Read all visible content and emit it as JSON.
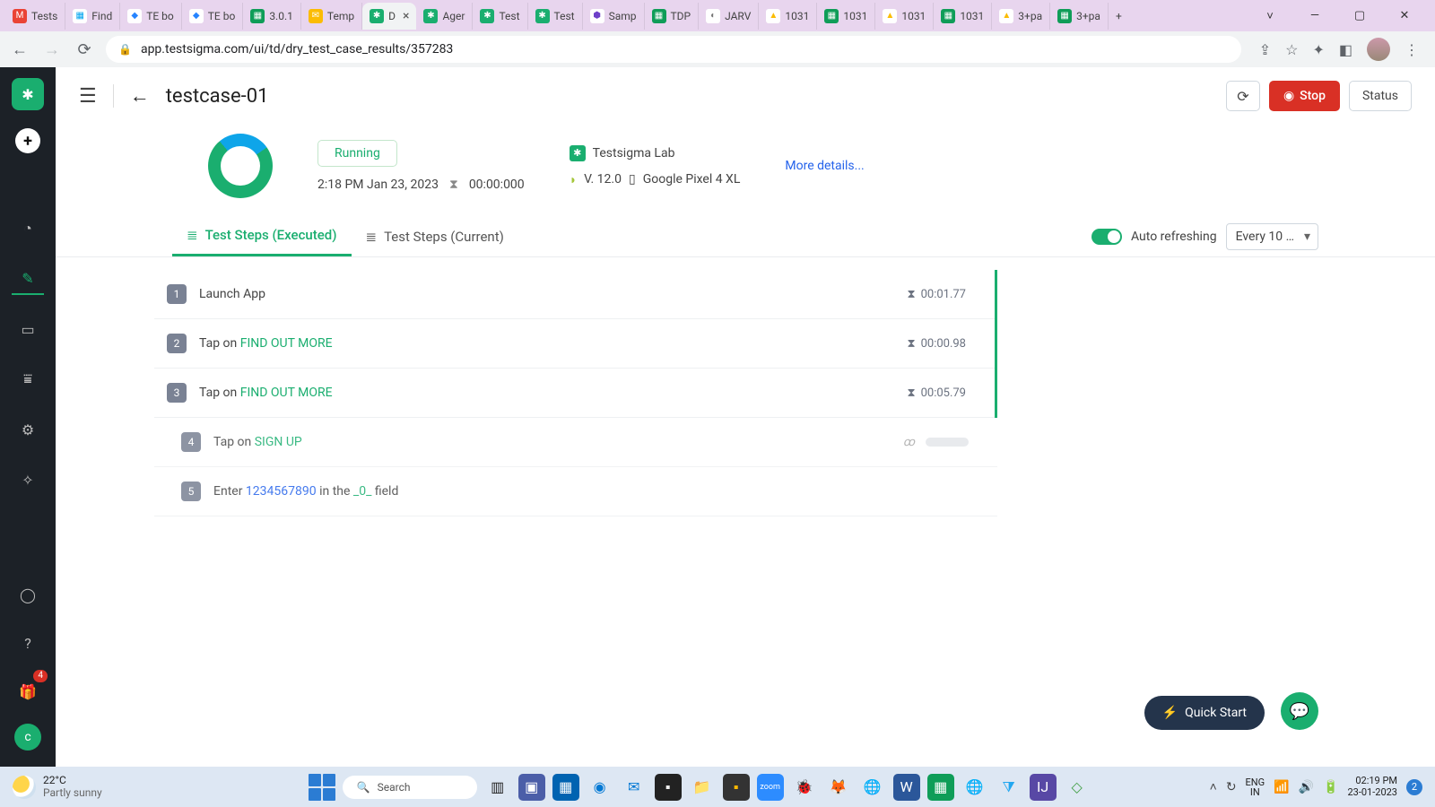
{
  "browser": {
    "tabs": [
      {
        "favicon": "M",
        "faviconBg": "#ea4335",
        "faviconColor": "#fff",
        "label": "Tests"
      },
      {
        "favicon": "▦",
        "faviconBg": "#fff",
        "faviconColor": "#00a4ef",
        "label": "Find"
      },
      {
        "favicon": "◆",
        "faviconBg": "#fff",
        "faviconColor": "#2684ff",
        "label": "TE bo"
      },
      {
        "favicon": "◆",
        "faviconBg": "#fff",
        "faviconColor": "#2684ff",
        "label": "TE bo"
      },
      {
        "favicon": "▦",
        "faviconBg": "#0f9d58",
        "faviconColor": "#fff",
        "label": "3.0.1"
      },
      {
        "favicon": "✉",
        "faviconBg": "#fbbc04",
        "faviconColor": "#fff",
        "label": "Temp"
      },
      {
        "favicon": "✱",
        "faviconBg": "#1aae6f",
        "faviconColor": "#fff",
        "label": "D",
        "active": true,
        "closable": true
      },
      {
        "favicon": "✱",
        "faviconBg": "#1aae6f",
        "faviconColor": "#fff",
        "label": "Ager"
      },
      {
        "favicon": "✱",
        "faviconBg": "#1aae6f",
        "faviconColor": "#fff",
        "label": "Test"
      },
      {
        "favicon": "✱",
        "faviconBg": "#1aae6f",
        "faviconColor": "#fff",
        "label": "Test"
      },
      {
        "favicon": "⬢",
        "faviconBg": "#fff",
        "faviconColor": "#6e40c9",
        "label": "Samp"
      },
      {
        "favicon": "▦",
        "faviconBg": "#0f9d58",
        "faviconColor": "#fff",
        "label": "TDP"
      },
      {
        "favicon": "◐",
        "faviconBg": "#fff",
        "faviconColor": "#777",
        "label": "JARV"
      },
      {
        "favicon": "▲",
        "faviconBg": "#fff",
        "faviconColor": "#fbbc04",
        "label": "1031"
      },
      {
        "favicon": "▦",
        "faviconBg": "#0f9d58",
        "faviconColor": "#fff",
        "label": "1031"
      },
      {
        "favicon": "▲",
        "faviconBg": "#fff",
        "faviconColor": "#fbbc04",
        "label": "1031"
      },
      {
        "favicon": "▦",
        "faviconBg": "#0f9d58",
        "faviconColor": "#fff",
        "label": "1031"
      },
      {
        "favicon": "▲",
        "faviconBg": "#fff",
        "faviconColor": "#fbbc04",
        "label": "3+pa"
      },
      {
        "favicon": "▦",
        "faviconBg": "#0f9d58",
        "faviconColor": "#fff",
        "label": "3+pa"
      }
    ],
    "url": "app.testsigma.com/ui/td/dry_test_case_results/357283"
  },
  "header": {
    "title": "testcase-01",
    "stop": "Stop",
    "status": "Status"
  },
  "summary": {
    "statusPill": "Running",
    "timestamp": "2:18 PM Jan 23, 2023",
    "duration": "00:00:000",
    "lab": "Testsigma Lab",
    "version": "V. 12.0",
    "device": "Google Pixel 4 XL",
    "moreLink": "More details..."
  },
  "tabs": {
    "executed": "Test Steps (Executed)",
    "current": "Test Steps (Current)",
    "autoRefresh": "Auto refreshing",
    "interval": "Every 10 …"
  },
  "steps": [
    {
      "n": "1",
      "prefix": "",
      "text": "Launch App",
      "link": "",
      "suffix": "",
      "time": "00:01.77",
      "done": true,
      "sub": false
    },
    {
      "n": "2",
      "prefix": "Tap on  ",
      "text": "",
      "link": "FIND OUT MORE",
      "suffix": "",
      "time": "00:00.98",
      "done": true,
      "sub": false
    },
    {
      "n": "3",
      "prefix": "Tap on  ",
      "text": "",
      "link": "FIND OUT MORE",
      "suffix": "",
      "time": "00:05.79",
      "done": true,
      "sub": false
    },
    {
      "n": "4",
      "prefix": "Tap on  ",
      "text": "",
      "link": "SIGN UP",
      "suffix": "",
      "time": "",
      "done": false,
      "sub": true
    },
    {
      "n": "5",
      "prefix": "Enter  ",
      "val": "1234567890",
      "mid": "  in the  ",
      "link": "_0_",
      "suffix": "  field",
      "time": "",
      "done": false,
      "sub": true
    }
  ],
  "quickStart": "Quick Start",
  "sidebar": {
    "badge": "4",
    "avatar": "c"
  },
  "taskbar": {
    "temp": "22°C",
    "cond": "Partly sunny",
    "search": "Search",
    "lang1": "ENG",
    "lang2": "IN",
    "time": "02:19 PM",
    "date": "23-01-2023",
    "notif": "2"
  }
}
